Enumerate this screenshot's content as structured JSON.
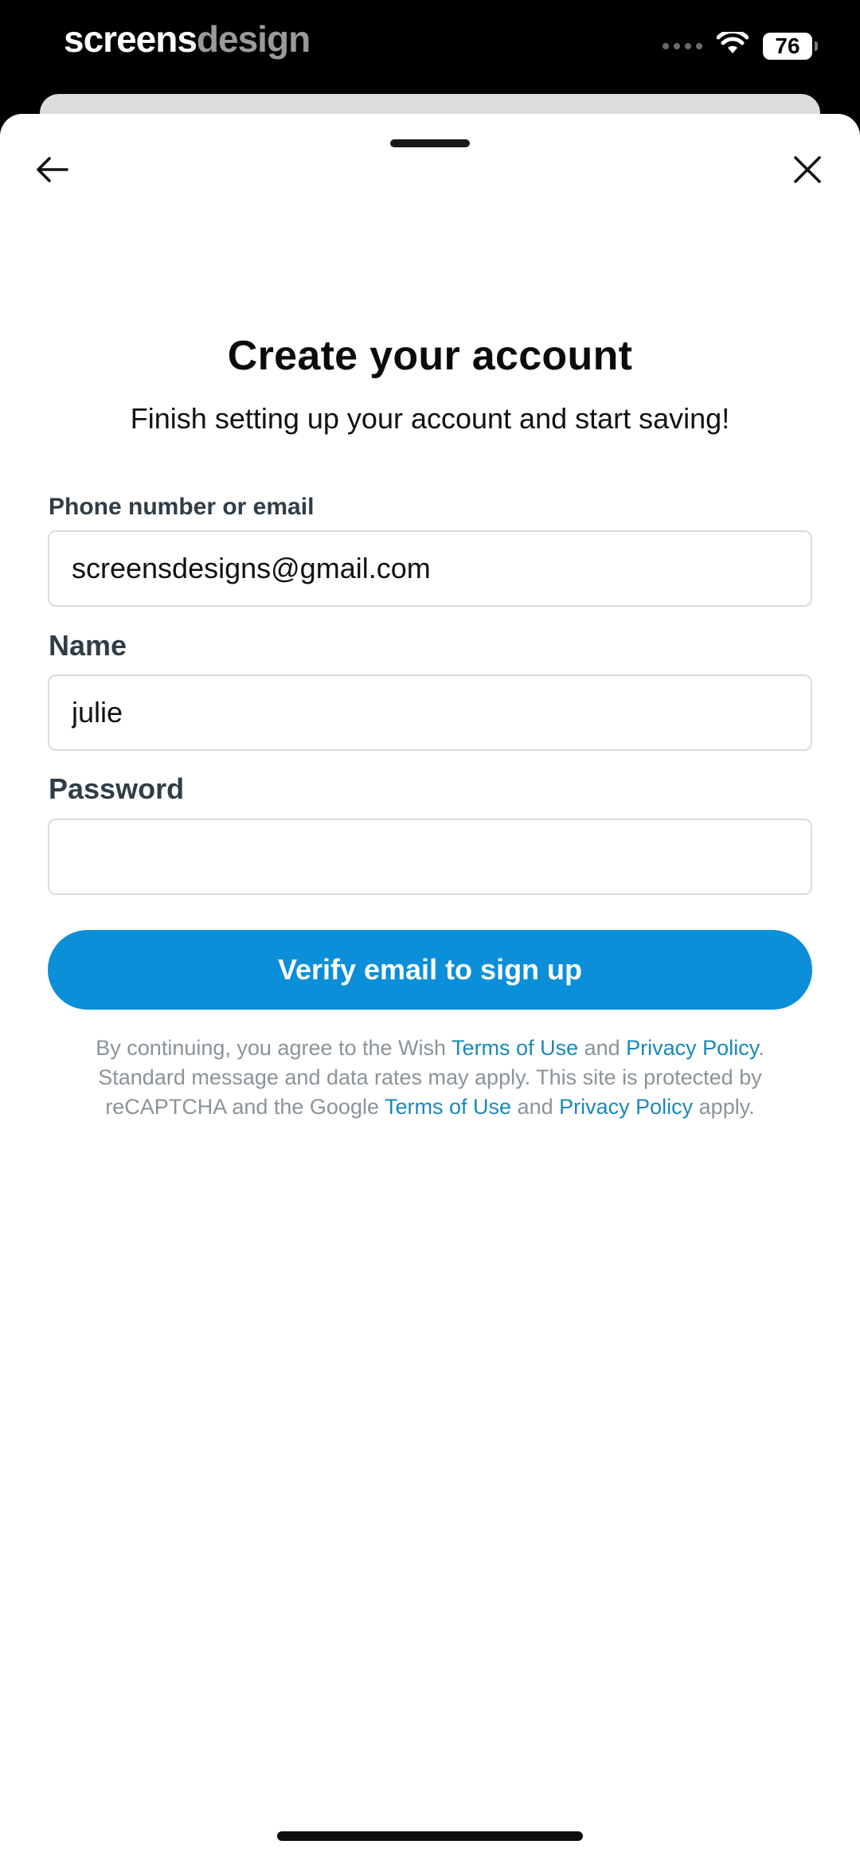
{
  "status_bar": {
    "brand_bold": "screens",
    "brand_light": "design",
    "battery": "76",
    "icons": [
      "signal-dots-icon",
      "wifi-icon",
      "battery-icon"
    ]
  },
  "nav": {
    "back_icon": "arrow-left-icon",
    "close_icon": "close-icon"
  },
  "header": {
    "title": "Create your account",
    "subtitle": "Finish setting up your account and start saving!"
  },
  "form": {
    "email_label": "Phone number or email",
    "email_value": "screensdesigns@gmail.com",
    "name_label": "Name",
    "name_value": "julie",
    "password_label": "Password",
    "password_value": ""
  },
  "cta": {
    "label": "Verify email to sign up",
    "color": "#0b8fd8"
  },
  "legal": {
    "part1": "By continuing, you agree to the Wish ",
    "link1": "Terms of Use",
    "part2": " and ",
    "link2": "Privacy Policy",
    "part3": ". Standard message and data rates may apply. This site is protected by reCAPTCHA and the Google ",
    "link3": "Terms of Use",
    "part4": " and ",
    "link4": "Privacy Policy",
    "part5": " apply.",
    "link_color": "#1a88b8"
  }
}
